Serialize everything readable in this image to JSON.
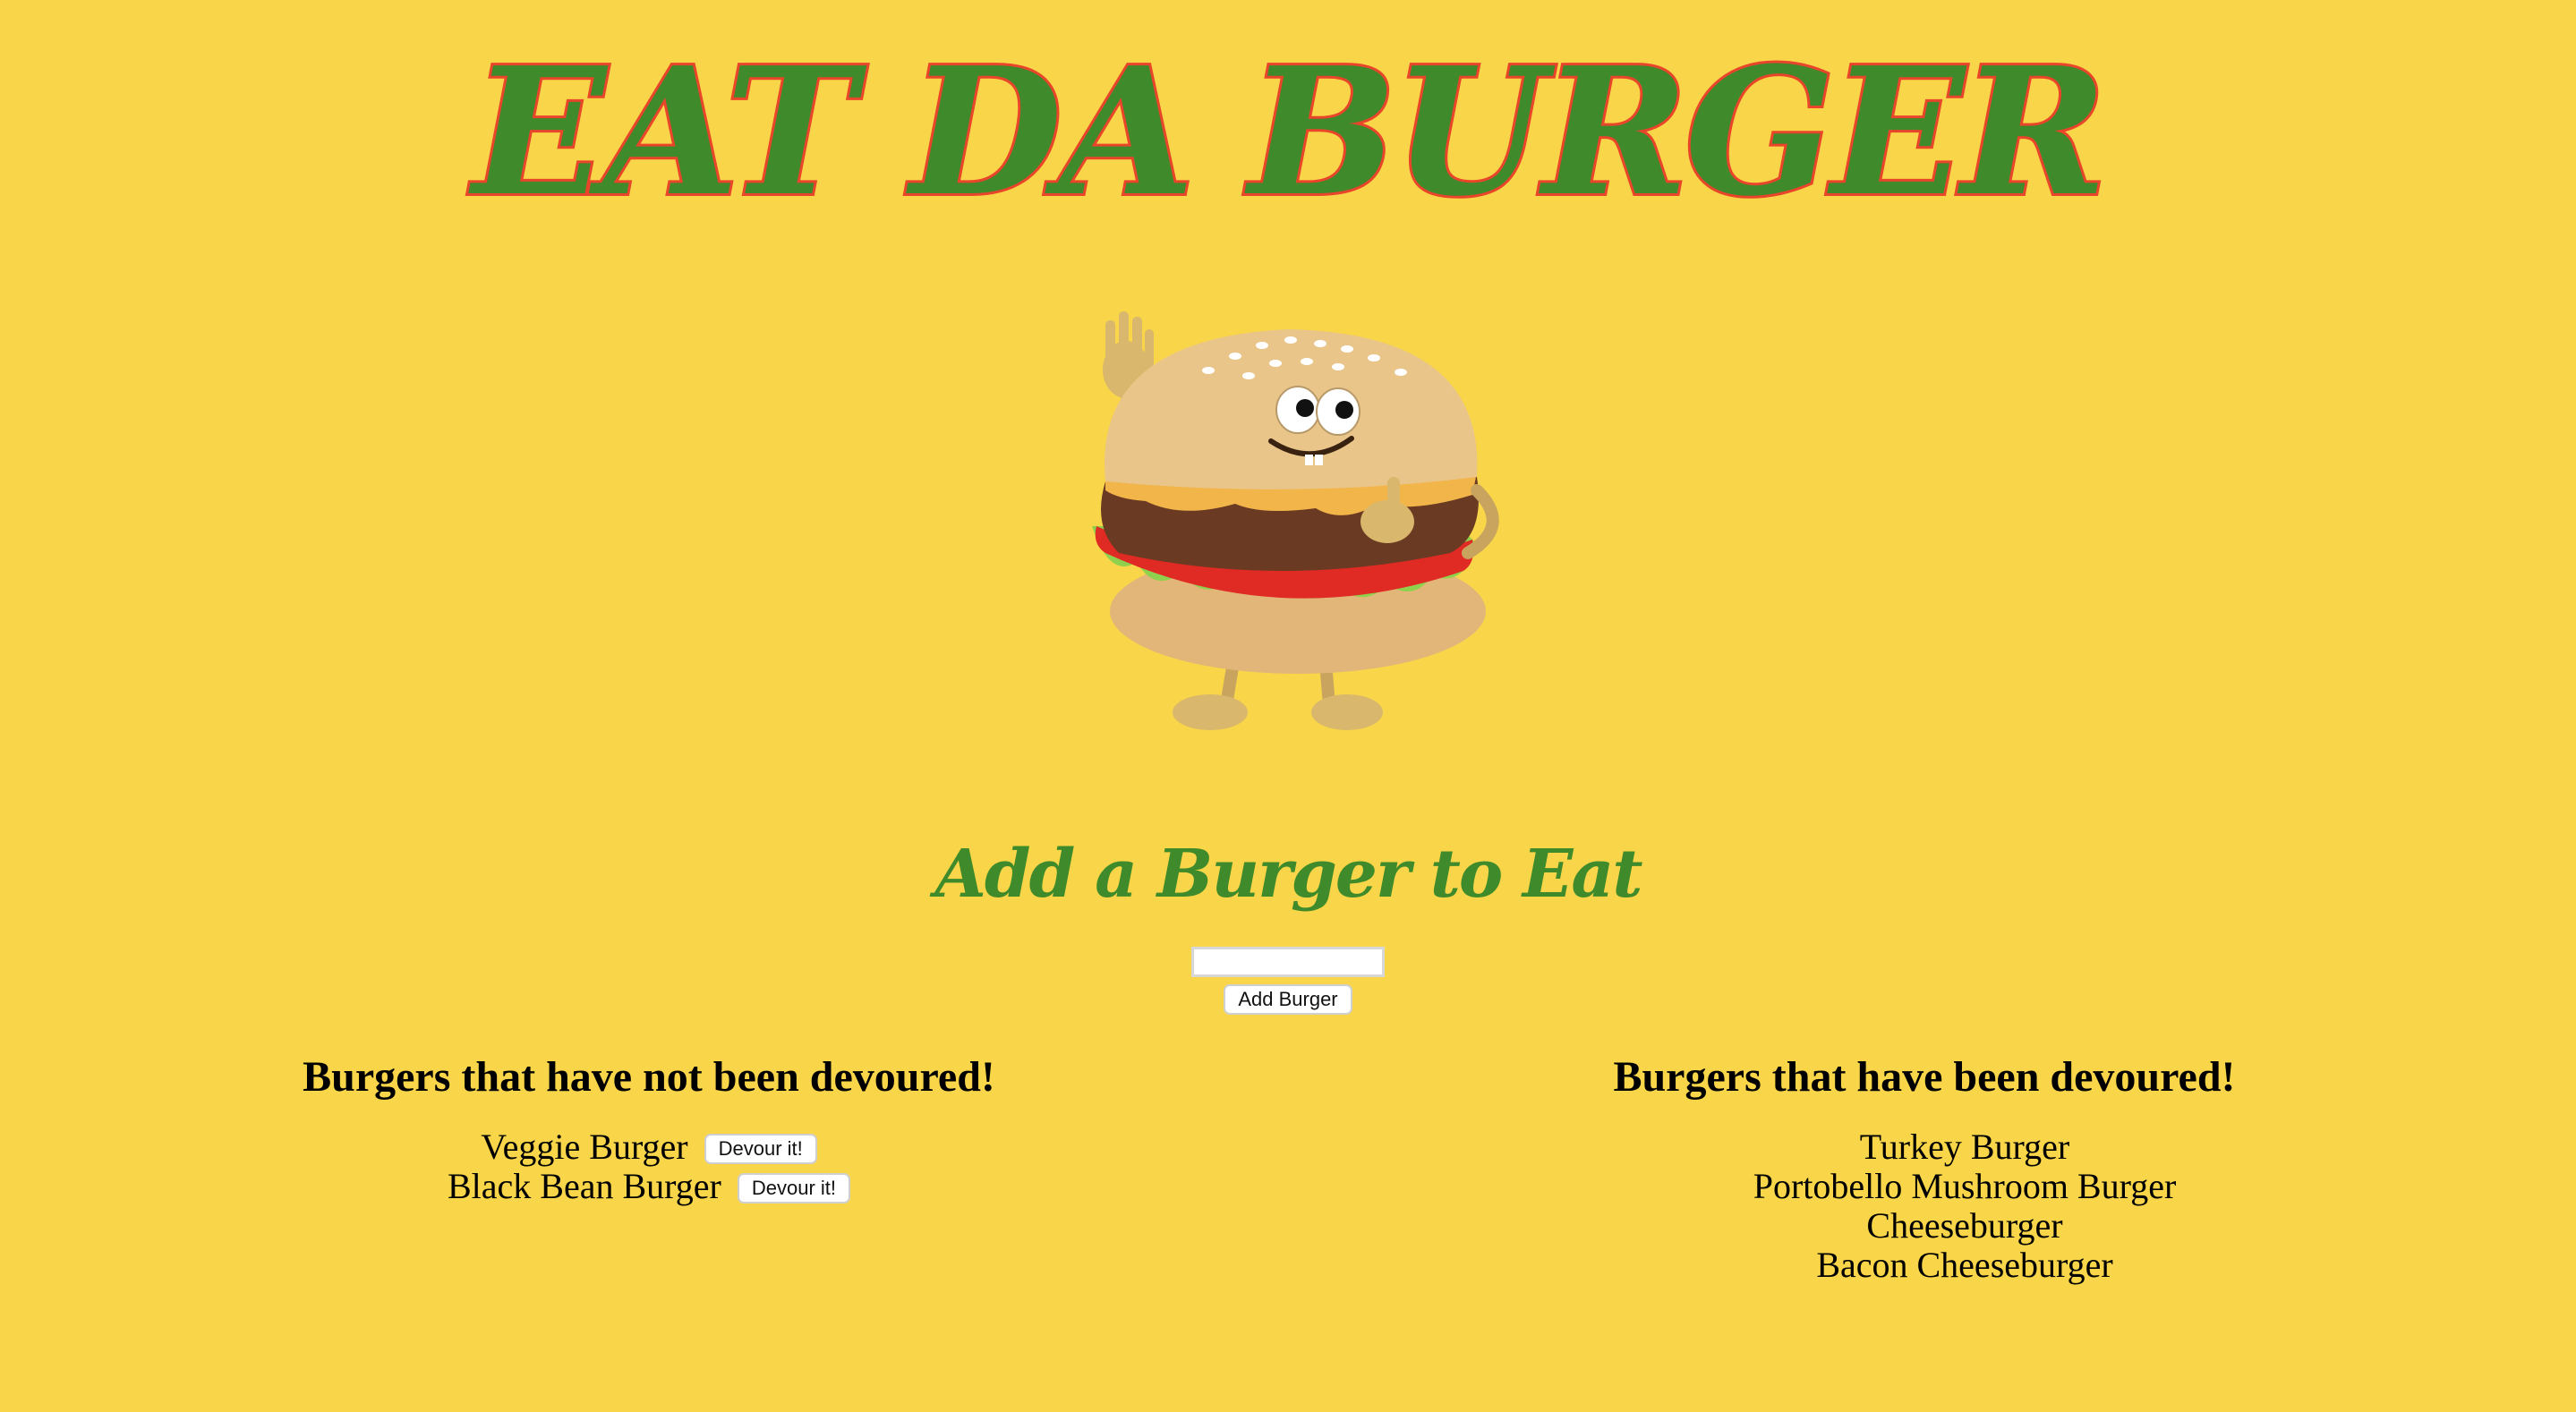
{
  "header": {
    "title": "EAT DA BURGER"
  },
  "mascot": {
    "icon": "burger-mascot-icon"
  },
  "form": {
    "heading": "Add a Burger to Eat",
    "input_value": "",
    "input_placeholder": "",
    "submit_label": "Add Burger"
  },
  "not_devoured": {
    "heading": "Burgers that have not been devoured!",
    "items": [
      {
        "name": "Veggie Burger",
        "button": "Devour it!"
      },
      {
        "name": "Black Bean Burger",
        "button": "Devour it!"
      }
    ]
  },
  "devoured": {
    "heading": "Burgers that have been devoured!",
    "items": [
      {
        "name": "Turkey Burger"
      },
      {
        "name": "Portobello Mushroom Burger"
      },
      {
        "name": "Cheeseburger"
      },
      {
        "name": "Bacon Cheeseburger"
      }
    ]
  },
  "colors": {
    "background": "#f9d649",
    "title_fill": "#3f8a2a",
    "title_stroke": "#e8452a"
  }
}
